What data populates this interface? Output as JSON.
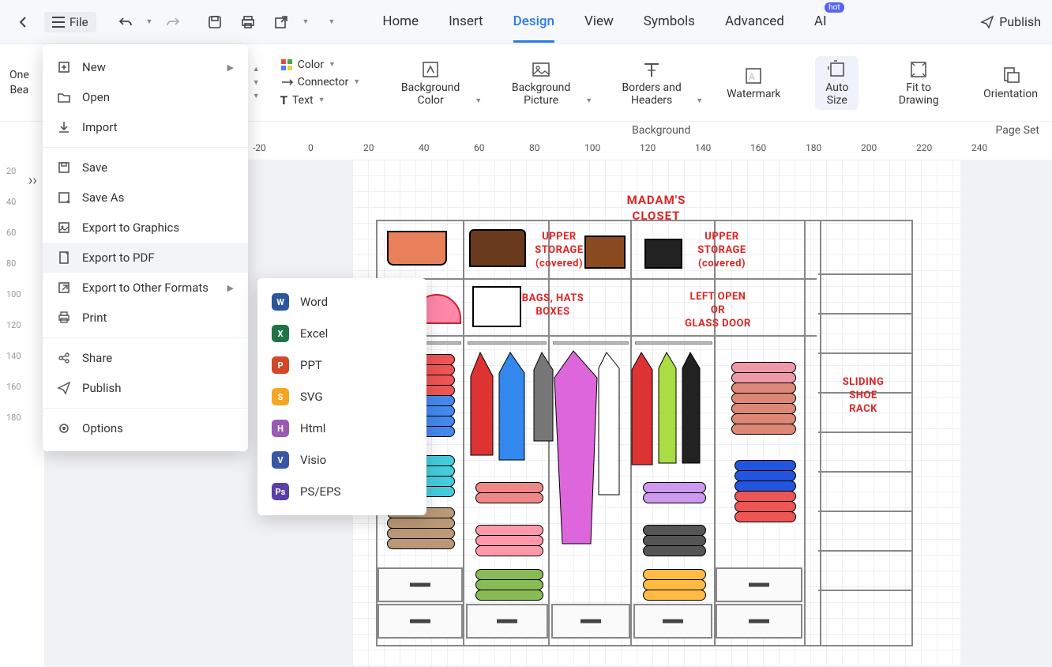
{
  "topbar": {
    "file_label": "File",
    "publish_label": "Publish"
  },
  "tabs": {
    "home": "Home",
    "insert": "Insert",
    "design": "Design",
    "view": "View",
    "symbols": "Symbols",
    "advanced": "Advanced",
    "ai": "AI"
  },
  "ribbon": {
    "page_line1": "One",
    "page_line2": "Bea",
    "color": "Color",
    "connector": "Connector",
    "text": "Text",
    "bg_color": "Background Color",
    "bg_picture": "Background Picture",
    "borders": "Borders and Headers",
    "watermark": "Watermark",
    "auto_size": "Auto Size",
    "fit": "Fit to Drawing",
    "orientation": "Orientation"
  },
  "subbar": {
    "background": "Background",
    "page_set": "Page Set"
  },
  "ruler": [
    "-20",
    "0",
    "20",
    "40",
    "60",
    "80",
    "100",
    "120",
    "140",
    "160",
    "180",
    "200",
    "220",
    "240"
  ],
  "vruler": [
    "20",
    "40",
    "60",
    "80",
    "100",
    "120",
    "140",
    "160",
    "180"
  ],
  "file_menu": {
    "new": "New",
    "open": "Open",
    "import": "Import",
    "save": "Save",
    "save_as": "Save As",
    "export_graphics": "Export to Graphics",
    "export_pdf": "Export to PDF",
    "export_other": "Export to Other Formats",
    "print": "Print",
    "share": "Share",
    "publish": "Publish",
    "options": "Options"
  },
  "sub_menu": {
    "word": "Word",
    "excel": "Excel",
    "ppt": "PPT",
    "svg": "SVG",
    "html": "Html",
    "visio": "Visio",
    "ps": "PS/EPS"
  },
  "closet": {
    "title_l1": "MADAM'S",
    "title_l2": "CLOSET",
    "upper1_l1": "UPPER",
    "upper1_l2": "STORAGE",
    "upper1_l3": "(covered)",
    "upper2_l1": "UPPER",
    "upper2_l2": "STORAGE",
    "upper2_l3": "(covered)",
    "bags_l1": "BAGS, HATS",
    "bags_l2": "BOXES",
    "left_l1": "LEFT OPEN",
    "left_l2": "OR",
    "left_l3": "GLASS DOOR",
    "shoe_l1": "SLIDING",
    "shoe_l2": "SHOE",
    "shoe_l3": "RACK"
  }
}
